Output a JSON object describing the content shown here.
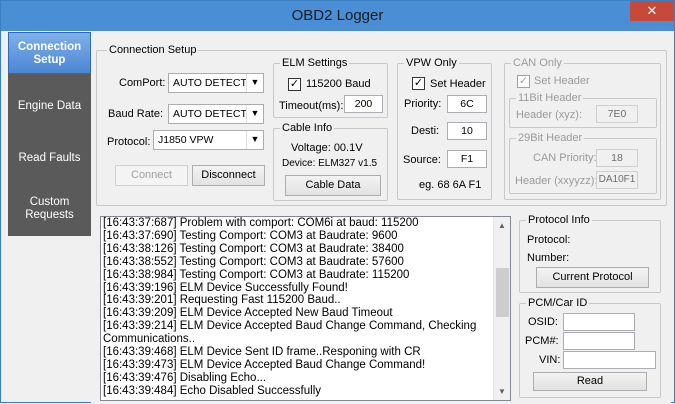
{
  "window": {
    "title": "OBD2 Logger",
    "close_glyph": "✕"
  },
  "sidebar": {
    "tabs": [
      {
        "label": "Connection Setup"
      },
      {
        "label": "Engine Data"
      },
      {
        "label": "Read Faults"
      },
      {
        "label": "Custom Requests"
      }
    ]
  },
  "connection": {
    "group_title": "Connection Setup",
    "comport_label": "ComPort:",
    "comport_value": "AUTO DETECT",
    "baud_label": "Baud Rate:",
    "baud_value": "AUTO DETECT",
    "protocol_label": "Protocol:",
    "protocol_value": "J1850 VPW",
    "connect_label": "Connect",
    "disconnect_label": "Disconnect"
  },
  "elm": {
    "group_title": "ELM Settings",
    "baud_checkbox_label": "115200 Baud",
    "baud_checked": true,
    "timeout_label": "Timeout(ms):",
    "timeout_value": "200"
  },
  "cable": {
    "group_title": "Cable Info",
    "voltage_text": "Voltage: 00.1V",
    "device_text": "Device: ELM327 v1.5",
    "button_label": "Cable Data"
  },
  "vpw": {
    "group_title": "VPW Only",
    "set_header_label": "Set Header",
    "set_header_checked": true,
    "priority_label": "Priority:",
    "priority_value": "6C",
    "desti_label": "Desti:",
    "desti_value": "10",
    "source_label": "Source:",
    "source_value": "F1",
    "example_text": "eg. 68 6A F1"
  },
  "can": {
    "group_title": "CAN Only",
    "set_header_label": "Set Header",
    "set_header_checked": true,
    "h11_title": "11Bit Header",
    "h11_label": "Header (xyz):",
    "h11_value": "7E0",
    "h29_title": "29Bit Header",
    "priority_label": "CAN Priority:",
    "priority_value": "18",
    "header_label": "Header (xxyyzz):",
    "header_value": "DA10F1"
  },
  "log": {
    "lines": [
      "[16:43:37:687]   Problem with comport: COM6i at baud: 115200",
      "[16:43:37:690]   Testing Comport: COM3 at Baudrate: 9600",
      "[16:43:38:126]   Testing Comport: COM3 at Baudrate: 38400",
      "[16:43:38:552]   Testing Comport: COM3 at Baudrate: 57600",
      "[16:43:38:984]   Testing Comport: COM3 at Baudrate: 115200",
      "[16:43:39:196]   ELM Device Successfully Found!",
      "[16:43:39:201]   Requesting Fast 115200 Baud..",
      "[16:43:39:209]   ELM Device Accepted New Baud Timeout",
      "[16:43:39:214]   ELM Device Accepted Baud Change Command, Checking",
      "Communications..",
      "[16:43:39:468]   ELM Device Sent ID frame..Responing with CR",
      "[16:43:39:473]   ELM Device Accepted Baud Change Command!",
      "[16:43:39:476]   Disabling Echo...",
      "[16:43:39:484]   Echo Disabled Successfully"
    ]
  },
  "protocol_info": {
    "group_title": "Protocol Info",
    "protocol_label": "Protocol:",
    "number_label": "Number:",
    "button_label": "Current Protocol"
  },
  "pcm": {
    "group_title": "PCM/Car ID",
    "osid_label": "OSID:",
    "osid_value": "",
    "pcm_label": "PCM#:",
    "pcm_value": "",
    "vin_label": "VIN:",
    "vin_value": "",
    "read_label": "Read"
  }
}
